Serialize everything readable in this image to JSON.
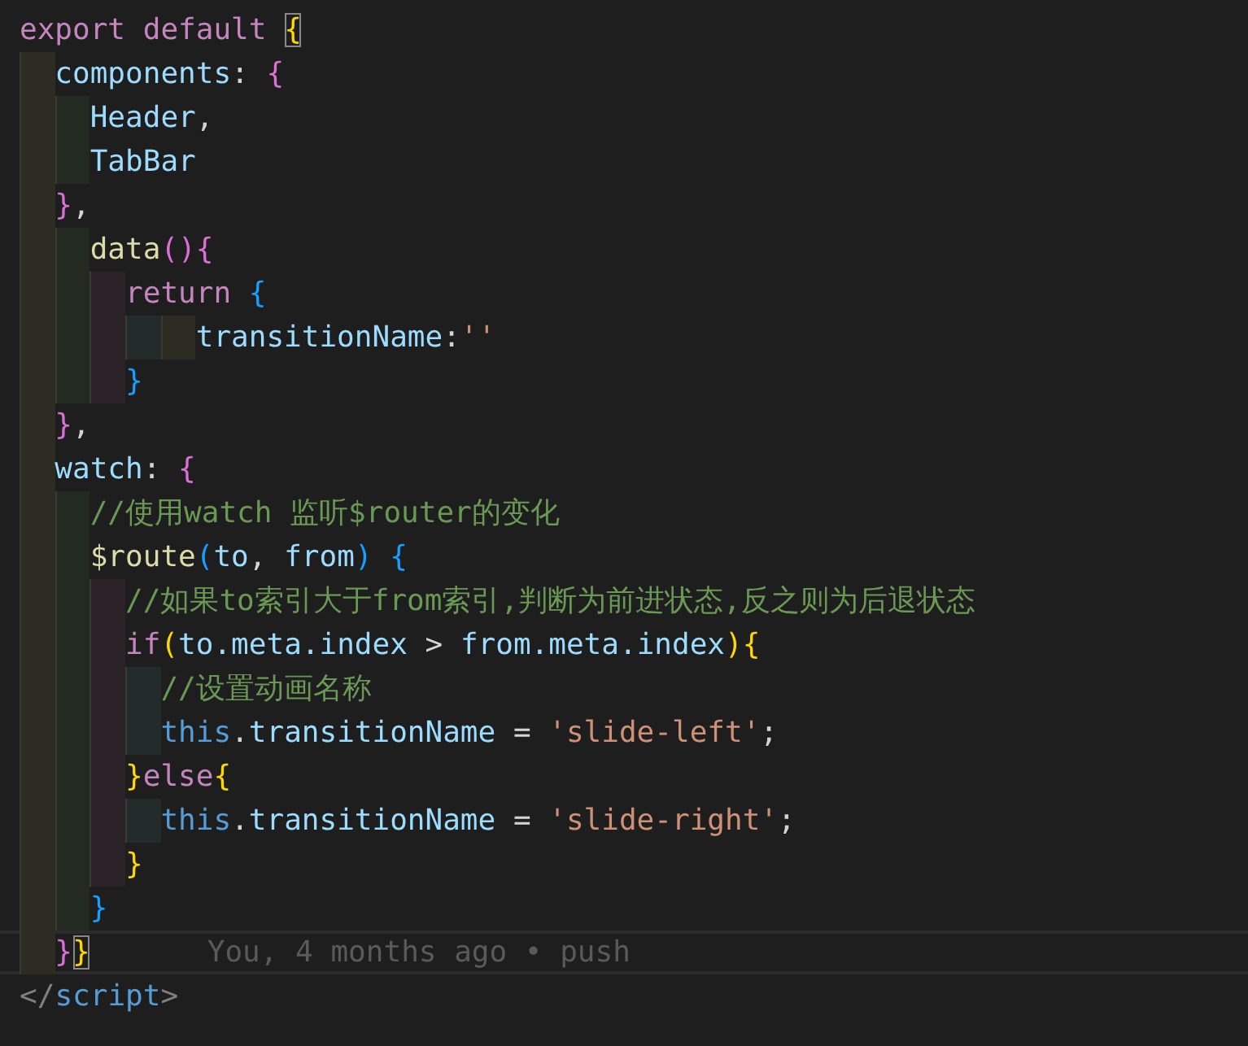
{
  "editor": {
    "lines": [
      {
        "tokens": [
          {
            "kind": "keyword",
            "text": "export default "
          },
          {
            "kind": "bracket",
            "text": "{",
            "color": "#ffd700",
            "matched": true
          }
        ],
        "children": [
          {
            "tokens": [
              {
                "kind": "property",
                "text": "components"
              },
              {
                "kind": "plain",
                "text": ": "
              },
              {
                "kind": "bracket",
                "text": "{",
                "color": "#da70d6"
              }
            ],
            "children": [
              {
                "tokens": [
                  {
                    "kind": "property",
                    "text": "Header"
                  },
                  {
                    "kind": "plain",
                    "text": ","
                  }
                ]
              },
              {
                "tokens": [
                  {
                    "kind": "property",
                    "text": "TabBar"
                  }
                ]
              }
            ]
          },
          {
            "tokens": [
              {
                "kind": "bracket",
                "text": "}",
                "color": "#da70d6"
              },
              {
                "kind": "plain",
                "text": ","
              }
            ]
          },
          {
            "children": [
              {
                "tokens": [
                  {
                    "kind": "function",
                    "text": "data"
                  },
                  {
                    "kind": "bracket",
                    "text": "()",
                    "color": "#da70d6"
                  },
                  {
                    "kind": "bracket",
                    "text": "{",
                    "color": "#da70d6"
                  }
                ],
                "children": [
                  {
                    "tokens": [
                      {
                        "kind": "keyword",
                        "text": "return "
                      },
                      {
                        "kind": "bracket",
                        "text": "{",
                        "color": "#179fff"
                      }
                    ],
                    "children": [
                      {
                        "children": [
                          {
                            "tokens": [
                              {
                                "kind": "property",
                                "text": "transitionName"
                              },
                              {
                                "kind": "plain",
                                "text": ":"
                              },
                              {
                                "kind": "string",
                                "text": "''"
                              }
                            ]
                          }
                        ]
                      }
                    ]
                  },
                  {
                    "tokens": [
                      {
                        "kind": "bracket",
                        "text": "}",
                        "color": "#179fff"
                      }
                    ]
                  }
                ]
              }
            ]
          },
          {
            "tokens": [
              {
                "kind": "bracket",
                "text": "}",
                "color": "#da70d6"
              },
              {
                "kind": "plain",
                "text": ","
              }
            ]
          },
          {
            "tokens": [
              {
                "kind": "property",
                "text": "watch"
              },
              {
                "kind": "plain",
                "text": ": "
              },
              {
                "kind": "bracket",
                "text": "{",
                "color": "#da70d6"
              }
            ],
            "children": [
              {
                "tokens": [
                  {
                    "kind": "comment",
                    "text": "//使用watch 监听$router的变化"
                  }
                ]
              },
              {
                "tokens": [
                  {
                    "kind": "function",
                    "text": "$route"
                  },
                  {
                    "kind": "bracket",
                    "text": "(",
                    "color": "#179fff"
                  },
                  {
                    "kind": "property",
                    "text": "to"
                  },
                  {
                    "kind": "plain",
                    "text": ", "
                  },
                  {
                    "kind": "property",
                    "text": "from"
                  },
                  {
                    "kind": "bracket",
                    "text": ")",
                    "color": "#179fff"
                  },
                  {
                    "kind": "bracket",
                    "text": " {",
                    "color": "#179fff"
                  }
                ],
                "children": [
                  {
                    "tokens": [
                      {
                        "kind": "comment",
                        "text": "//如果to索引大于from索引,判断为前进状态,反之则为后退状态"
                      }
                    ]
                  },
                  {
                    "tokens": [
                      {
                        "kind": "keyword",
                        "text": "if"
                      },
                      {
                        "kind": "bracket",
                        "text": "(",
                        "color": "#ffd700"
                      },
                      {
                        "kind": "property",
                        "text": "to.meta.index"
                      },
                      {
                        "kind": "plain",
                        "text": " > "
                      },
                      {
                        "kind": "property",
                        "text": "from.meta.index"
                      },
                      {
                        "kind": "bracket",
                        "text": ")",
                        "color": "#ffd700"
                      },
                      {
                        "kind": "bracket",
                        "text": "{",
                        "color": "#ffd700"
                      }
                    ],
                    "children": [
                      {
                        "tokens": [
                          {
                            "kind": "comment",
                            "text": "//设置动画名称"
                          }
                        ]
                      },
                      {
                        "tokens": [
                          {
                            "kind": "this",
                            "text": "this"
                          },
                          {
                            "kind": "plain",
                            "text": "."
                          },
                          {
                            "kind": "property",
                            "text": "transitionName"
                          },
                          {
                            "kind": "plain",
                            "text": " = "
                          },
                          {
                            "kind": "string",
                            "text": "'slide-left'"
                          },
                          {
                            "kind": "plain",
                            "text": ";"
                          }
                        ]
                      }
                    ]
                  },
                  {
                    "tokens": [
                      {
                        "kind": "bracket",
                        "text": "}",
                        "color": "#ffd700"
                      },
                      {
                        "kind": "keyword",
                        "text": "else"
                      },
                      {
                        "kind": "bracket",
                        "text": "{",
                        "color": "#ffd700"
                      }
                    ],
                    "children": [
                      {
                        "tokens": [
                          {
                            "kind": "this",
                            "text": "this"
                          },
                          {
                            "kind": "plain",
                            "text": "."
                          },
                          {
                            "kind": "property",
                            "text": "transitionName"
                          },
                          {
                            "kind": "plain",
                            "text": " = "
                          },
                          {
                            "kind": "string",
                            "text": "'slide-right'"
                          },
                          {
                            "kind": "plain",
                            "text": ";"
                          }
                        ]
                      }
                    ]
                  },
                  {
                    "tokens": [
                      {
                        "kind": "bracket",
                        "text": "}",
                        "color": "#ffd700"
                      }
                    ]
                  }
                ]
              },
              {
                "tokens": [
                  {
                    "kind": "bracket",
                    "text": "}",
                    "color": "#179fff"
                  }
                ]
              }
            ]
          },
          {
            "current": true,
            "blame": "You, 4 months ago • push",
            "tokens": [
              {
                "kind": "bracket",
                "text": "}",
                "color": "#da70d6"
              },
              {
                "kind": "bracket",
                "text": "}",
                "color": "#ffd700",
                "matched": true
              }
            ]
          }
        ]
      },
      {
        "tokens": [
          {
            "kind": "tag",
            "text": "</"
          },
          {
            "kind": "tagname",
            "text": "script"
          },
          {
            "kind": "tag",
            "text": ">"
          }
        ]
      }
    ]
  }
}
